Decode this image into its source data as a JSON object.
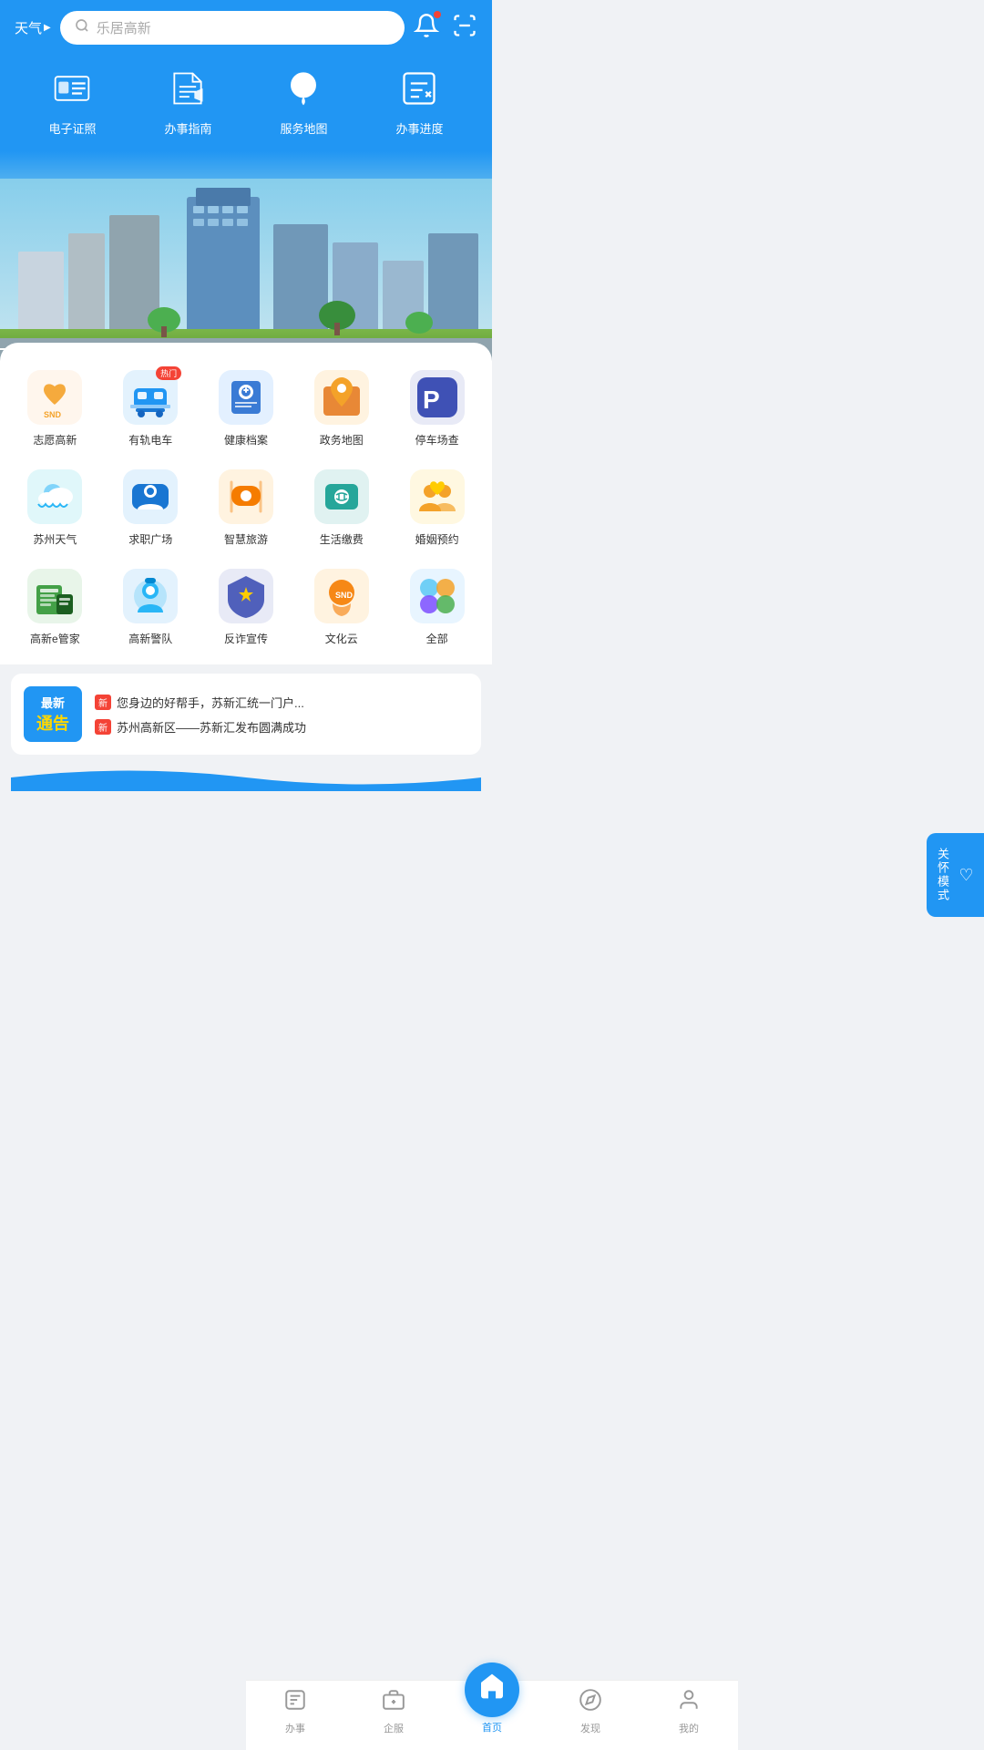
{
  "header": {
    "weather_label": "天气",
    "search_placeholder": "乐居高新",
    "bell_icon": "bell-icon",
    "scan_icon": "scan-icon"
  },
  "quick_access": [
    {
      "id": "id-card",
      "label": "电子证照",
      "icon": "id"
    },
    {
      "id": "guide",
      "label": "办事指南",
      "icon": "folder"
    },
    {
      "id": "map",
      "label": "服务地图",
      "icon": "map"
    },
    {
      "id": "progress",
      "label": "办事进度",
      "icon": "progress"
    }
  ],
  "apps": [
    {
      "id": "volunteer",
      "label": "志愿高新",
      "bg": "#fff",
      "hot": false
    },
    {
      "id": "tram",
      "label": "有轨电车",
      "bg": "#fff",
      "hot": true
    },
    {
      "id": "health",
      "label": "健康档案",
      "bg": "#fff",
      "hot": false
    },
    {
      "id": "govt-map",
      "label": "政务地图",
      "bg": "#fff",
      "hot": false
    },
    {
      "id": "parking",
      "label": "停车场查",
      "bg": "#fff",
      "hot": false
    },
    {
      "id": "weather",
      "label": "苏州天气",
      "bg": "#fff",
      "hot": false
    },
    {
      "id": "jobs",
      "label": "求职广场",
      "bg": "#fff",
      "hot": false
    },
    {
      "id": "tourism",
      "label": "智慧旅游",
      "bg": "#fff",
      "hot": false
    },
    {
      "id": "bills",
      "label": "生活缴费",
      "bg": "#fff",
      "hot": false
    },
    {
      "id": "marriage",
      "label": "婚姻预约",
      "bg": "#fff",
      "hot": false
    },
    {
      "id": "manager",
      "label": "高新e管家",
      "bg": "#fff",
      "hot": false
    },
    {
      "id": "police",
      "label": "高新警队",
      "bg": "#fff",
      "hot": false
    },
    {
      "id": "anti-fraud",
      "label": "反诈宣传",
      "bg": "#fff",
      "hot": false
    },
    {
      "id": "culture",
      "label": "文化云",
      "bg": "#fff",
      "hot": false
    },
    {
      "id": "all",
      "label": "全部",
      "bg": "#fff",
      "hot": false
    }
  ],
  "care_mode": {
    "label": "关怀模式",
    "heart": "♡"
  },
  "news": {
    "badge_top": "最新",
    "badge_bottom": "通告",
    "items": [
      {
        "tag": "新",
        "text": "您身边的好帮手，苏新汇统一门户..."
      },
      {
        "tag": "新",
        "text": "苏州高新区——苏新汇发布圆满成功"
      }
    ]
  },
  "bottom_nav": [
    {
      "id": "tasks",
      "label": "办事",
      "icon": "📋",
      "active": false
    },
    {
      "id": "enterprise",
      "label": "企服",
      "icon": "🏢",
      "active": false
    },
    {
      "id": "home",
      "label": "首页",
      "icon": "🏠",
      "active": true,
      "center": true
    },
    {
      "id": "discover",
      "label": "发现",
      "icon": "🔍",
      "active": false
    },
    {
      "id": "mine",
      "label": "我的",
      "icon": "👤",
      "active": false
    }
  ]
}
